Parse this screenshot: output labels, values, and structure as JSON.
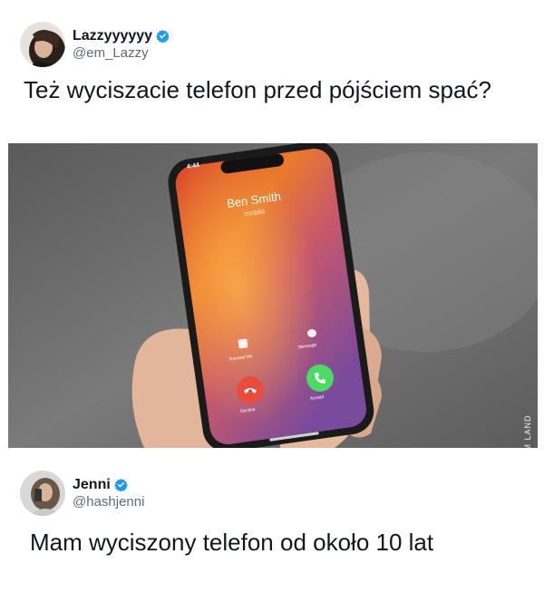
{
  "tweet1": {
    "display_name": "Lazzyyyyyy",
    "handle": "@em_Lazzy",
    "text": "Też wyciszacie telefon przed pójściem spać?"
  },
  "photo": {
    "time": "4:44",
    "caller_name": "Ben Smith",
    "caller_label": "mobile",
    "remind_label": "Remind Me",
    "message_label": "Message",
    "decline_label": "Decline",
    "accept_label": "Accept",
    "watermark": "MEM LAND"
  },
  "tweet2": {
    "display_name": "Jenni",
    "handle": "@hashjenni",
    "text": "Mam wyciszony telefon od około 10 lat"
  },
  "colors": {
    "verified": "#1d9bf0",
    "decline": "#e94b3c",
    "accept": "#4cd964"
  }
}
